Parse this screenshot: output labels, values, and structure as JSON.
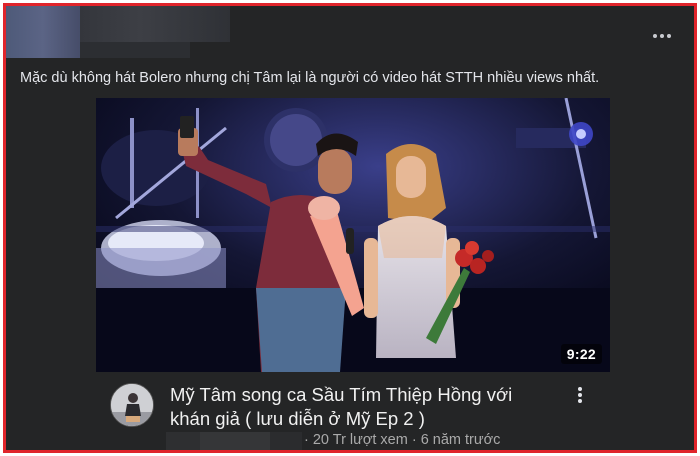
{
  "post": {
    "caption": "Mặc dù không hát Bolero nhưng chị Tâm lại là người có video hát STTH nhiều views nhất.",
    "more_icon": "more-horizontal-icon"
  },
  "video": {
    "duration": "9:22",
    "title_line1": "Mỹ Tâm song ca Sầu Tím Thiệp Hồng với",
    "title_line2": "khán giả ( lưu diễn ở Mỹ  Ep 2 )",
    "meta": "· 20 Tr lượt xem · 6 năm trước",
    "more_icon": "more-vertical-icon"
  },
  "colors": {
    "highlight_border": "#e0242b",
    "card_bg": "#242526",
    "text_primary": "#e4e6eb",
    "text_secondary": "#aaaaaa"
  }
}
